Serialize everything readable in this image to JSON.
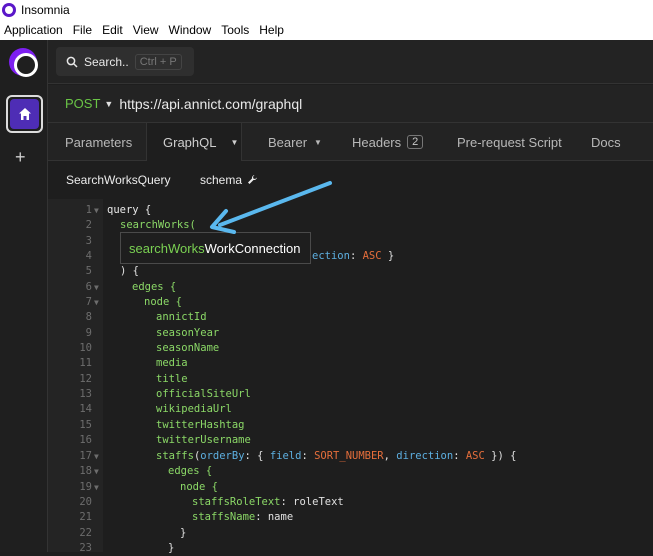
{
  "app": {
    "title": "Insomnia"
  },
  "menu": [
    "Application",
    "File",
    "Edit",
    "View",
    "Window",
    "Tools",
    "Help"
  ],
  "search": {
    "label": "Search..",
    "shortcut": "Ctrl + P"
  },
  "sidebar": {
    "add": "+"
  },
  "request": {
    "method": "POST",
    "url": "https://api.annict.com/graphql"
  },
  "tabs": [
    {
      "label": "Parameters"
    },
    {
      "label": "GraphQL"
    },
    {
      "label": "Bearer"
    },
    {
      "label": "Headers",
      "badge": "2"
    },
    {
      "label": "Pre-request Script"
    },
    {
      "label": "Docs"
    }
  ],
  "subbar": {
    "query_name": "SearchWorksQuery",
    "schema": "schema"
  },
  "tooltip": {
    "field": "searchWorks",
    "type": "WorkConnection"
  },
  "code": {
    "l1": {
      "n": "1",
      "t1": "query {"
    },
    "l2": {
      "n": "2",
      "t1": "searchWorks("
    },
    "l3": {
      "n": "3"
    },
    "l4": {
      "n": "4",
      "t1": "ection",
      "t2": ": ",
      "t3": "ASC",
      "t4": " }"
    },
    "l5": {
      "n": "5",
      "t1": ") {"
    },
    "l6": {
      "n": "6",
      "t1": "edges {"
    },
    "l7": {
      "n": "7",
      "t1": "node {"
    },
    "l8": {
      "n": "8",
      "t1": "annictId"
    },
    "l9": {
      "n": "9",
      "t1": "seasonYear"
    },
    "l10": {
      "n": "10",
      "t1": "seasonName"
    },
    "l11": {
      "n": "11",
      "t1": "media"
    },
    "l12": {
      "n": "12",
      "t1": "title"
    },
    "l13": {
      "n": "13",
      "t1": "officialSiteUrl"
    },
    "l14": {
      "n": "14",
      "t1": "wikipediaUrl"
    },
    "l15": {
      "n": "15",
      "t1": "twitterHashtag"
    },
    "l16": {
      "n": "16",
      "t1": "twitterUsername"
    },
    "l17": {
      "n": "17",
      "t1": "staffs",
      "t2": "(",
      "t3": "orderBy",
      "t4": ": { ",
      "t5": "field",
      "t6": ": ",
      "t7": "SORT_NUMBER",
      "t8": ", ",
      "t9": "direction",
      "t10": ": ",
      "t11": "ASC",
      "t12": " }) {"
    },
    "l18": {
      "n": "18",
      "t1": "edges {"
    },
    "l19": {
      "n": "19",
      "t1": "node {"
    },
    "l20": {
      "n": "20",
      "t1": "staffsRoleText",
      "t2": ": roleText"
    },
    "l21": {
      "n": "21",
      "t1": "staffsName",
      "t2": ": name"
    },
    "l22": {
      "n": "22",
      "t1": "}"
    },
    "l23": {
      "n": "23",
      "t1": "}"
    }
  },
  "colors": {
    "accent": "#7d1ff1",
    "method": "#6ac546",
    "arrow": "#5ab8ee",
    "field": "#8bd867",
    "argument": "#5dafe0",
    "enum": "#e56e3b"
  }
}
